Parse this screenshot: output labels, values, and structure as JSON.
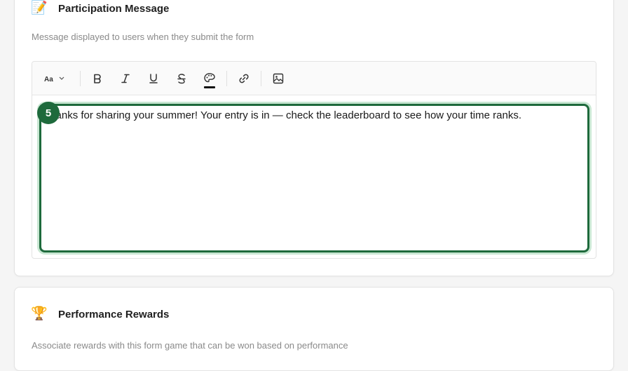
{
  "participation": {
    "emoji": "📝",
    "title": "Participation Message",
    "description": "Message displayed to users when they submit the form",
    "editor": {
      "toolbar": {
        "font_size_label": "Aa",
        "buttons": [
          "font-size",
          "bold",
          "italic",
          "underline",
          "strikethrough",
          "text-color",
          "link",
          "image"
        ]
      },
      "badge": "5",
      "content": "Thanks for sharing your summer! Your entry is in — check the leaderboard to see how your time ranks."
    }
  },
  "rewards": {
    "emoji": "🏆",
    "title": "Performance Rewards",
    "description": "Associate rewards with this form game that can be won based on performance"
  },
  "colors": {
    "accent": "#1e6a3c",
    "accent_glow": "#c9e7d3"
  }
}
